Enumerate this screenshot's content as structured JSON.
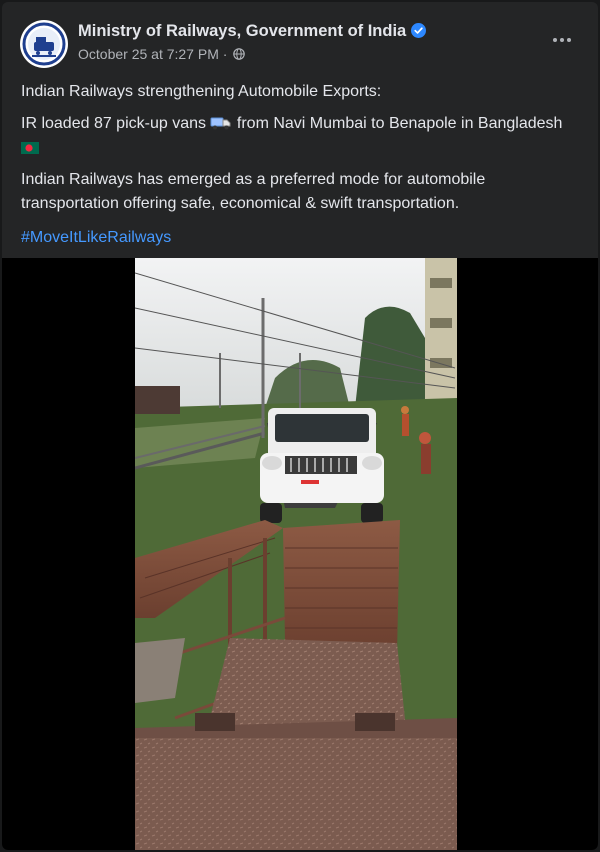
{
  "post": {
    "page_name": "Ministry of Railways, Government of India",
    "timestamp": "October 25 at 7:27 PM",
    "separator": "·",
    "privacy_icon": "globe-icon",
    "verified_icon": "verified-badge-icon",
    "more_icon": "more-options-icon",
    "lines": {
      "headline": "Indian Railways strengthening Automobile Exports:",
      "loaded_prefix": "IR loaded 87 pick-up vans",
      "loaded_suffix": "from Navi Mumbai to Benapole in Bangladesh",
      "description": "Indian Railways has emerged as a preferred mode for automobile transportation offering safe, economical & swift transportation."
    },
    "hashtag": "#MoveItLikeRailways",
    "colors": {
      "background": "#242526",
      "text": "#e4e6eb",
      "secondary_text": "#b0b3b8",
      "link": "#4599ff",
      "verified": "#2d88ff"
    }
  }
}
